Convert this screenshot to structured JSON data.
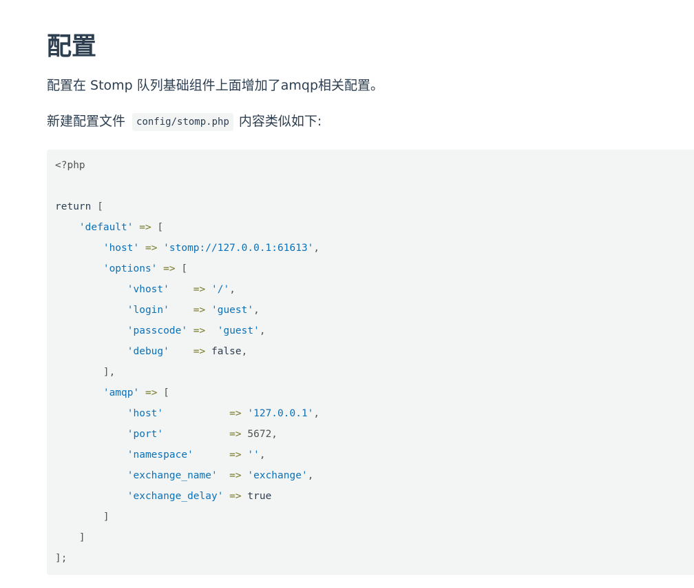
{
  "heading": "配置",
  "intro": "配置在 Stomp 队列基础组件上面增加了amqp相关配置。",
  "new_file": {
    "before": "新建配置文件",
    "code": "config/stomp.php",
    "after": "内容类似如下:"
  },
  "code_block": {
    "language": "php",
    "lines": [
      [
        {
          "t": "<?php",
          "k": "plain"
        }
      ],
      [],
      [
        {
          "t": "return",
          "k": "kw"
        },
        {
          "t": " [",
          "k": "plain"
        }
      ],
      [
        {
          "t": "    ",
          "k": "plain"
        },
        {
          "t": "'default'",
          "k": "str"
        },
        {
          "t": " => ",
          "k": "op"
        },
        {
          "t": "[",
          "k": "plain"
        }
      ],
      [
        {
          "t": "        ",
          "k": "plain"
        },
        {
          "t": "'host'",
          "k": "str"
        },
        {
          "t": " => ",
          "k": "op"
        },
        {
          "t": "'stomp://127.0.0.1:61613'",
          "k": "str"
        },
        {
          "t": ",",
          "k": "plain"
        }
      ],
      [
        {
          "t": "        ",
          "k": "plain"
        },
        {
          "t": "'options'",
          "k": "str"
        },
        {
          "t": " => ",
          "k": "op"
        },
        {
          "t": "[",
          "k": "plain"
        }
      ],
      [
        {
          "t": "            ",
          "k": "plain"
        },
        {
          "t": "'vhost'",
          "k": "str"
        },
        {
          "t": "    => ",
          "k": "op"
        },
        {
          "t": "'/'",
          "k": "str"
        },
        {
          "t": ",",
          "k": "plain"
        }
      ],
      [
        {
          "t": "            ",
          "k": "plain"
        },
        {
          "t": "'login'",
          "k": "str"
        },
        {
          "t": "    => ",
          "k": "op"
        },
        {
          "t": "'guest'",
          "k": "str"
        },
        {
          "t": ",",
          "k": "plain"
        }
      ],
      [
        {
          "t": "            ",
          "k": "plain"
        },
        {
          "t": "'passcode'",
          "k": "str"
        },
        {
          "t": " =>  ",
          "k": "op"
        },
        {
          "t": "'guest'",
          "k": "str"
        },
        {
          "t": ",",
          "k": "plain"
        }
      ],
      [
        {
          "t": "            ",
          "k": "plain"
        },
        {
          "t": "'debug'",
          "k": "str"
        },
        {
          "t": "    => ",
          "k": "op"
        },
        {
          "t": "false",
          "k": "kw"
        },
        {
          "t": ",",
          "k": "plain"
        }
      ],
      [
        {
          "t": "        ],",
          "k": "plain"
        }
      ],
      [
        {
          "t": "        ",
          "k": "plain"
        },
        {
          "t": "'amqp'",
          "k": "str"
        },
        {
          "t": " => ",
          "k": "op"
        },
        {
          "t": "[",
          "k": "plain"
        }
      ],
      [
        {
          "t": "            ",
          "k": "plain"
        },
        {
          "t": "'host'",
          "k": "str"
        },
        {
          "t": "           => ",
          "k": "op"
        },
        {
          "t": "'127.0.0.1'",
          "k": "str"
        },
        {
          "t": ",",
          "k": "plain"
        }
      ],
      [
        {
          "t": "            ",
          "k": "plain"
        },
        {
          "t": "'port'",
          "k": "str"
        },
        {
          "t": "           => ",
          "k": "op"
        },
        {
          "t": "5672",
          "k": "num"
        },
        {
          "t": ",",
          "k": "plain"
        }
      ],
      [
        {
          "t": "            ",
          "k": "plain"
        },
        {
          "t": "'namespace'",
          "k": "str"
        },
        {
          "t": "      => ",
          "k": "op"
        },
        {
          "t": "''",
          "k": "str"
        },
        {
          "t": ",",
          "k": "plain"
        }
      ],
      [
        {
          "t": "            ",
          "k": "plain"
        },
        {
          "t": "'exchange_name'",
          "k": "str"
        },
        {
          "t": "  => ",
          "k": "op"
        },
        {
          "t": "'exchange'",
          "k": "str"
        },
        {
          "t": ",",
          "k": "plain"
        }
      ],
      [
        {
          "t": "            ",
          "k": "plain"
        },
        {
          "t": "'exchange_delay'",
          "k": "str"
        },
        {
          "t": " => ",
          "k": "op"
        },
        {
          "t": "true",
          "k": "kw"
        }
      ],
      [
        {
          "t": "        ]",
          "k": "plain"
        }
      ],
      [
        {
          "t": "    ]",
          "k": "plain"
        }
      ],
      [
        {
          "t": "];",
          "k": "plain"
        }
      ]
    ]
  },
  "colors": {
    "text": "#2c3e50",
    "code_background": "#f3f4f4",
    "code_string": "#0b71b8",
    "code_plain": "#525252",
    "code_operator": "#7a7a2a"
  }
}
